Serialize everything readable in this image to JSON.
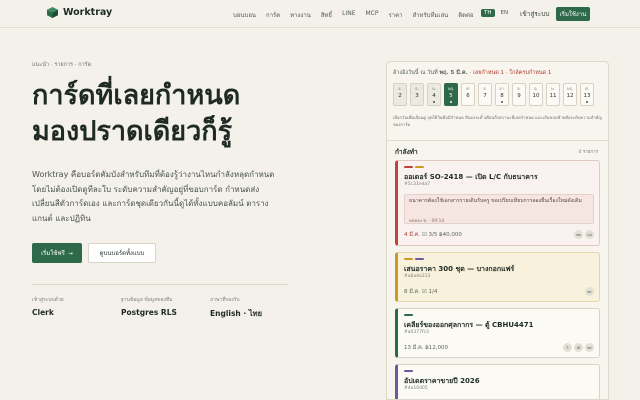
{
  "header": {
    "brand": "Worktray",
    "nav": [
      "บอนบอน",
      "การ์ด",
      "ทางงาน",
      "สิทธิ์",
      "LINE",
      "MCP",
      "ราคา",
      "สำหรับทีมเล่น",
      "ติดต่อ"
    ],
    "lang": [
      "TH",
      "EN"
    ],
    "login": "เข้าสู่ระบบ",
    "start": "เริ่มใช้งาน"
  },
  "hero": {
    "breadcrumb": "แนะนำ · รายการ · การ์ด",
    "title_line1": "การ์ดที่เลยกำหนด",
    "title_line2": "มองปราดเดียวก็รู้",
    "description": "Worktray คือบอร์ดคัมบังสำหรับทีมที่ต้องรู้ว่างานไหนกำลังหลุดกำหนด โดยไม่ต้องเปิดดูทีละใบ ระดับความสำคัญอยู่ที่ขอบการ์ด กำหนดส่งเปลี่ยนสีตัวการ์ดเอง และการ์ดชุดเดียวกันนี้ดูได้ทั้งแบบคอลัมน์ ตาราง แกนต์ และปฏิทิน",
    "cta_primary": "เริ่มใช้ฟรี",
    "cta_primary_arrow": "→",
    "cta_secondary": "ดูบนบอร์ดทั้งแบบ"
  },
  "stats": [
    {
      "label": "เข้าสู่ระบบด้วย",
      "value": "Clerk"
    },
    {
      "label": "ฐานข้อมูล ข้อมูลของทีม",
      "value": "Postgres RLS"
    },
    {
      "label": "ภาษาที่รองรับ",
      "value": "English · ไทย"
    }
  ],
  "panel": {
    "head_prefix": "อ้างอิงวันนี้ ณ วันที่",
    "head_date": "พฤ. 5 มี.ค.",
    "head_overdue": "เลยกำหนด 1",
    "head_soon": "ใกล้ครบกำหนด 1",
    "days": [
      {
        "name": "จ.",
        "num": "2",
        "state": "muted",
        "dot": false
      },
      {
        "name": "อ.",
        "num": "3",
        "state": "muted",
        "dot": false
      },
      {
        "name": "พ.",
        "num": "4",
        "state": "muted",
        "dot": true
      },
      {
        "name": "พฤ.",
        "num": "5",
        "state": "today",
        "dot": true
      },
      {
        "name": "ศ.",
        "num": "6",
        "state": "normal",
        "dot": false
      },
      {
        "name": "ส.",
        "num": "7",
        "state": "normal",
        "dot": false
      },
      {
        "name": "อา.",
        "num": "8",
        "state": "normal",
        "dot": true
      },
      {
        "name": "จ.",
        "num": "9",
        "state": "normal",
        "dot": false
      },
      {
        "name": "อ.",
        "num": "10",
        "state": "normal",
        "dot": false
      },
      {
        "name": "พ.",
        "num": "11",
        "state": "normal",
        "dot": false
      },
      {
        "name": "พฤ.",
        "num": "12",
        "state": "normal",
        "dot": false
      },
      {
        "name": "ศ.",
        "num": "13",
        "state": "normal",
        "dot": true
      }
    ],
    "note": "เลือกวันเพื่อเลื่อนดู จุดใต้วันคือมีกำหนด สีแดงจะย้ำเตือนถึงสถานะที่เลยกำหนด และเส้นขอบซ้ายคือระดับความสำคัญของการ์ด",
    "section_title": "กำลังทำ",
    "section_count": "4 รายการ"
  },
  "cards": [
    {
      "tags": [
        "#c0443a",
        "#c99a27"
      ],
      "title": "ออเดอร์ SO-2418 — เปิด L/C กับธนาคาร",
      "sub": "#5c31eda7",
      "comment": "ธนาคารต้องใช้เอกสารรายเดินรับครู ขอเปรียบเทียบการลองยื่นเรื่องใหม่ดังเดิม",
      "comment_meta": "ทดลอง ซ. · 09:14",
      "meta_due": "4 มี.ค.",
      "meta_rest": "☑ 3/5  ฿40,000",
      "avatars": [
        "พธ",
        "ฉป"
      ]
    },
    {
      "tags": [
        "#c99a27",
        "#6c5aa0"
      ],
      "title": "เสนอราคา 300 ชุด — บางกอกแฟร์",
      "sub": "#a6a4e213",
      "meta_due": "",
      "meta_rest": "8 มี.ค.  ☑ 1/4",
      "avatars": [
        "ศร"
      ]
    },
    {
      "tags": [
        "#2d6a4a"
      ],
      "title": "เคลียร์ของออกศุลกากร — ตู้ CBHU4471",
      "sub": "#a0377fc3",
      "meta_due": "",
      "meta_rest": "13 มี.ค.  ฿12,000",
      "avatars": [
        "วิ",
        "ณิ",
        "พร"
      ]
    },
    {
      "tags": [
        "#6c5aa0"
      ],
      "title": "อัปเดตราคาขายปี 2026",
      "sub": "#4e10d05",
      "meta_due": "",
      "meta_rest": "",
      "avatars": []
    }
  ]
}
